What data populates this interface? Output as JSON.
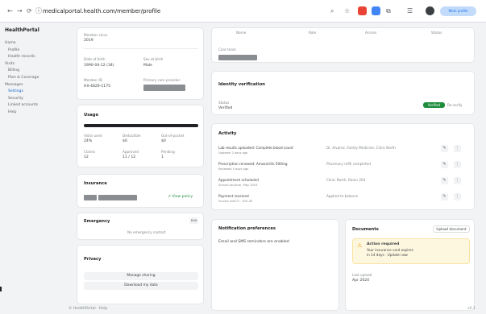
{
  "browser": {
    "url": "medicalportal.health.com/member/profile",
    "profile_label": "Work profile",
    "nav_icons": {
      "back": "←",
      "forward": "→",
      "reload": "⟳",
      "info": "ⓘ"
    }
  },
  "app": {
    "brand": "HealthPortal",
    "nav": [
      {
        "label": "Home",
        "indent": false,
        "active": false
      },
      {
        "label": "Profile",
        "indent": true,
        "active": false
      },
      {
        "label": "Health records",
        "indent": true,
        "active": false
      },
      {
        "label": "Visits",
        "indent": false,
        "active": false
      },
      {
        "label": "Billing",
        "indent": true,
        "active": false
      },
      {
        "label": "Plan & Coverage",
        "indent": true,
        "active": false
      },
      {
        "label": "Messages",
        "indent": false,
        "active": false
      },
      {
        "label": "Settings",
        "indent": true,
        "active": true
      },
      {
        "label": "Security",
        "indent": true,
        "active": false
      },
      {
        "label": "Linked accounts",
        "indent": true,
        "active": false
      },
      {
        "label": "Help",
        "indent": true,
        "active": false
      }
    ],
    "footer_left": "© HealthPortal · Help",
    "footer_right": "v2.1"
  },
  "profile": {
    "top_label": "Member since",
    "top_value": "2019",
    "fields": [
      {
        "label": "Date of birth",
        "value": "1990-04-12 (34)"
      },
      {
        "label": "Sex at birth",
        "value": "Male"
      },
      {
        "label": "Member ID",
        "value": "HX-4829-1175"
      },
      {
        "label": "Primary care provider",
        "value": ""
      }
    ]
  },
  "usage": {
    "title": "Usage",
    "progress": 1.0,
    "stats": [
      {
        "label": "Visits used",
        "value": "24%"
      },
      {
        "label": "Deductible",
        "value": "$0"
      },
      {
        "label": "Out-of-pocket",
        "value": "$0"
      },
      {
        "label": "Claims",
        "value": "12"
      },
      {
        "label": "Approved",
        "value": "11 / 12"
      },
      {
        "label": "Pending",
        "value": "1"
      }
    ]
  },
  "insurance": {
    "title": "Insurance",
    "link": "View policy"
  },
  "emergency": {
    "title": "Emergency",
    "badge": "Edit",
    "empty": "No emergency contact"
  },
  "privacy": {
    "title": "Privacy",
    "buttons": [
      "Manage sharing",
      "Download my data"
    ]
  },
  "right_top": {
    "columns": [
      "Name",
      "Role",
      "Access",
      "Status"
    ],
    "label": "Care team"
  },
  "verification": {
    "title": "Identity verification",
    "row_label": "Status",
    "row_value": "Verified",
    "button_primary": "Verified",
    "button_secondary": "Re-verify"
  },
  "activity": {
    "title": "Activity",
    "rows": [
      {
        "title": "Lab results uploaded: Complete blood count",
        "sub": "Updated 2 days ago",
        "right": "Dr. Alvarez, Family Medicine, Clinic North"
      },
      {
        "title": "Prescription renewed: Amoxicillin 500mg",
        "sub": "Renewed 5 days ago",
        "right": "Pharmacy refill completed"
      },
      {
        "title": "Appointment scheduled",
        "sub": "Annual physical, May 2024",
        "right": "Clinic North, Room 204"
      },
      {
        "title": "Payment received",
        "sub": "Invoice #4471 · $25.00",
        "right": "Applied to balance"
      }
    ]
  },
  "preferences": {
    "title": "Notification preferences",
    "text": "Email and SMS reminders are enabled"
  },
  "documents": {
    "title": "Documents",
    "button": "Upload document",
    "warning_title": "Action required",
    "warning_lines": [
      "Your insurance card expires",
      "in 14 days · Update now"
    ],
    "bottom_label": "Last upload",
    "bottom_value": "Apr 2024"
  },
  "colors": {
    "accent": "#1a73e8",
    "success": "#1e8e3e",
    "warning_bg": "#fef7e0"
  }
}
